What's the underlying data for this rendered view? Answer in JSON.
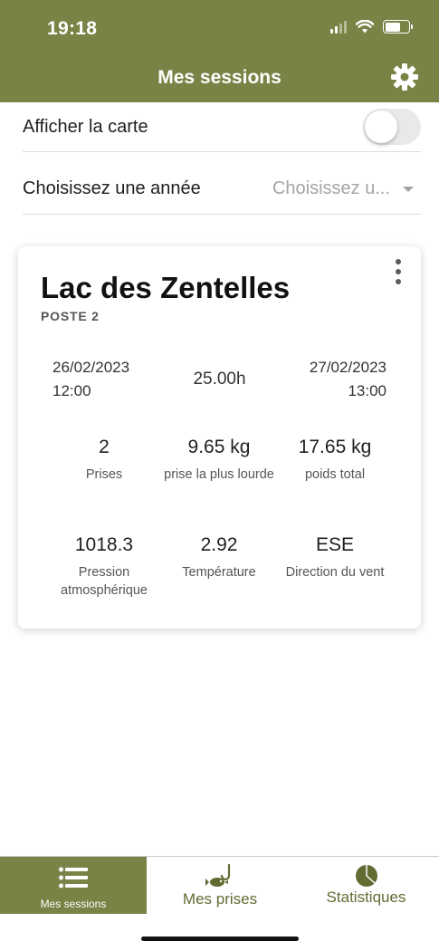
{
  "status_bar": {
    "time": "19:18"
  },
  "header": {
    "title": "Mes sessions",
    "settings_icon": "gear-icon"
  },
  "settings": {
    "map_label": "Afficher la carte",
    "map_toggle_on": false,
    "year_label": "Choisissez une année",
    "year_placeholder": "Choisissez u..."
  },
  "session": {
    "title": "Lac des Zentelles",
    "subtitle": "POSTE 2",
    "start_date": "26/02/2023",
    "start_time": "12:00",
    "duration": "25.00h",
    "end_date": "27/02/2023",
    "end_time": "13:00",
    "stats": [
      {
        "value": "2",
        "label": "Prises"
      },
      {
        "value": "9.65 kg",
        "label": "prise la plus lourde"
      },
      {
        "value": "17.65 kg",
        "label": "poids total"
      },
      {
        "value": "1018.3",
        "label": "Pression atmosphérique"
      },
      {
        "value": "2.92",
        "label": "Température"
      },
      {
        "value": "ESE",
        "label": "Direction du vent"
      }
    ]
  },
  "tabs": [
    {
      "label": "Mes sessions",
      "icon": "list-icon",
      "active": true
    },
    {
      "label": "Mes prises",
      "icon": "fish-hook-icon",
      "active": false
    },
    {
      "label": "Statistiques",
      "icon": "pie-chart-icon",
      "active": false
    }
  ],
  "colors": {
    "primary": "#7a8246",
    "tab_text": "#636b33"
  }
}
